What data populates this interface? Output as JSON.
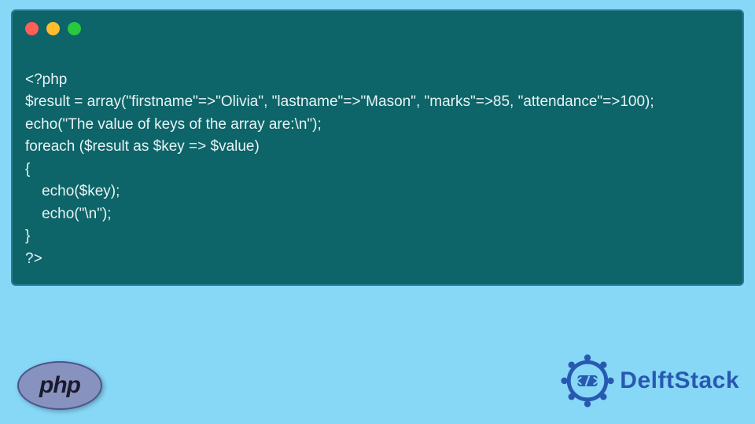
{
  "code": {
    "lines": [
      "<?php",
      "$result = array(\"firstname\"=>\"Olivia\", \"lastname\"=>\"Mason\", \"marks\"=>85, \"attendance\"=>100);",
      "echo(\"The value of keys of the array are:\\n\");",
      "foreach ($result as $key => $value)",
      "{",
      "    echo($key);",
      "    echo(\"\\n\");",
      "}",
      "?>"
    ]
  },
  "phpLogo": {
    "text": "php"
  },
  "brand": {
    "name": "DelftStack"
  }
}
